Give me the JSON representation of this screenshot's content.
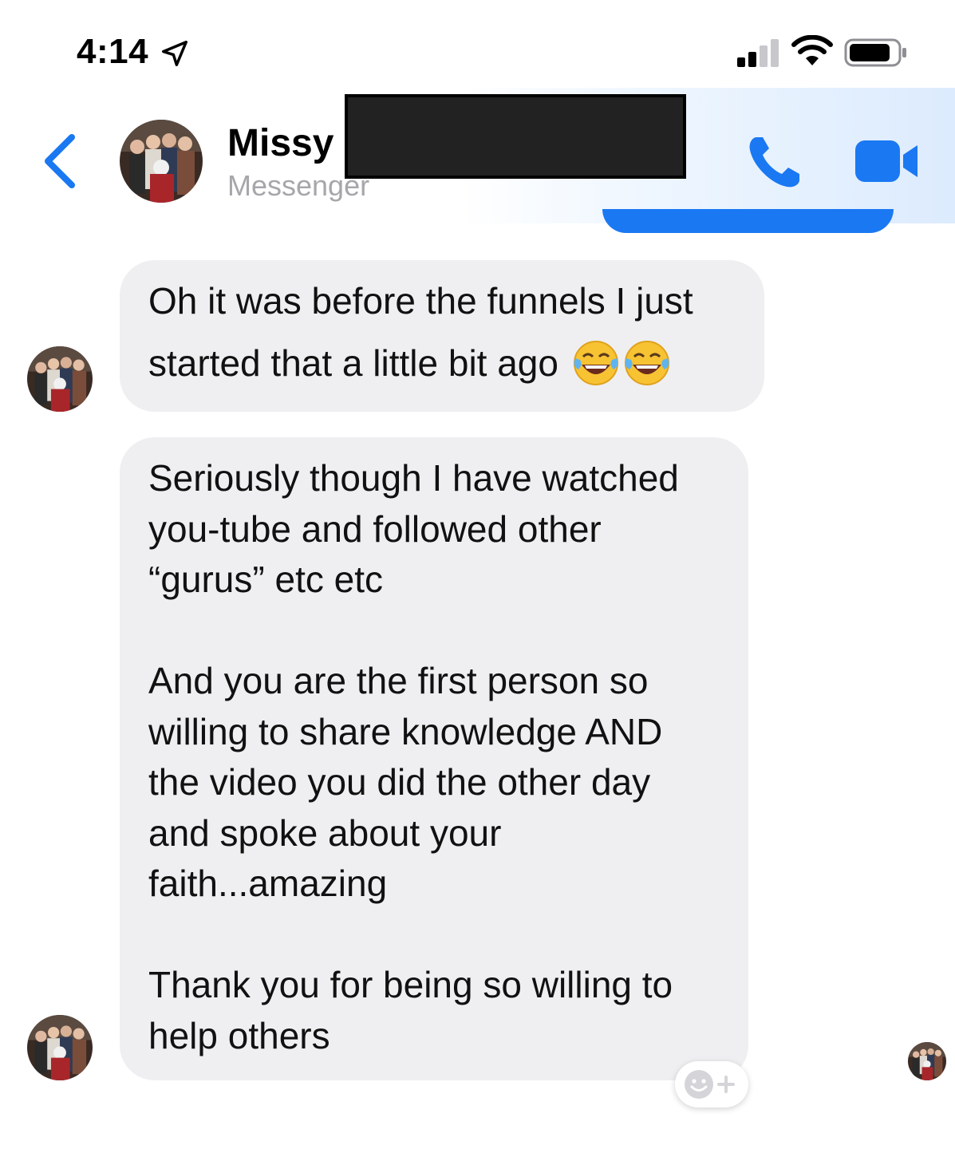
{
  "status_bar": {
    "time": "4:14",
    "icons": [
      "location-arrow-icon",
      "cellular-signal-icon",
      "wifi-icon",
      "battery-icon"
    ]
  },
  "header": {
    "contact_name": "Missy",
    "contact_subtitle": "Messenger",
    "icons": [
      "back-chevron-icon",
      "phone-icon",
      "video-camera-icon"
    ],
    "accent_color": "#1a78f2"
  },
  "messages": [
    {
      "sender": "Missy",
      "lines": [
        "Oh it was before the funnels I just",
        "started that a little bit ago"
      ],
      "emojis": [
        "😂",
        "😂"
      ]
    },
    {
      "sender": "Missy",
      "paragraphs": [
        [
          "Seriously though I have watched",
          "you-tube and followed other",
          "“gurus” etc etc"
        ],
        [
          "And you are the first person so",
          "willing to share knowledge AND",
          "the video you did the other day",
          "and spoke about your",
          "faith...amazing"
        ],
        [
          "Thank you for being so willing to",
          "help others"
        ]
      ]
    }
  ],
  "colors": {
    "bubble_bg": "#efeff2",
    "subtitle_gray": "#a6a6ab",
    "background": "#ffffff"
  }
}
